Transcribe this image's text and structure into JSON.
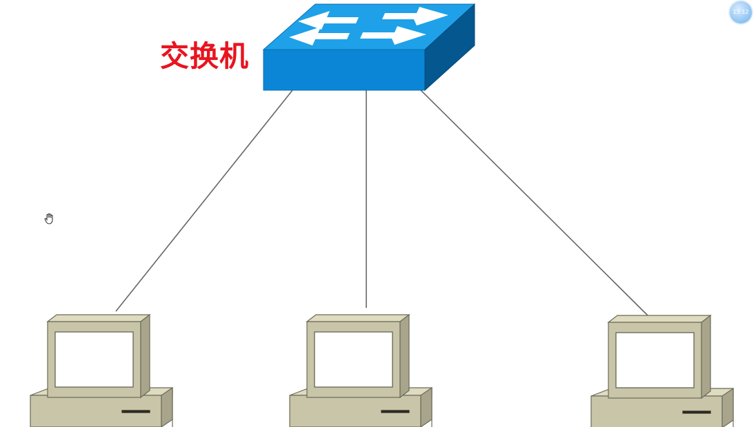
{
  "switch": {
    "label": "交换机",
    "label_color": "#e8141f",
    "icon": "network-switch-icon",
    "top_color": "#1ea1e8",
    "front_color": "#0b86d6",
    "side_color": "#05578f"
  },
  "hosts": [
    {
      "icon": "computer-icon"
    },
    {
      "icon": "computer-icon"
    },
    {
      "icon": "computer-icon"
    }
  ],
  "overlay": {
    "timer": "13:12",
    "cursor_icon": "hand-cursor-icon"
  },
  "colors": {
    "link_line": "#666666",
    "computer_body": "#c8c5a8",
    "computer_outline": "#6b6a58"
  }
}
